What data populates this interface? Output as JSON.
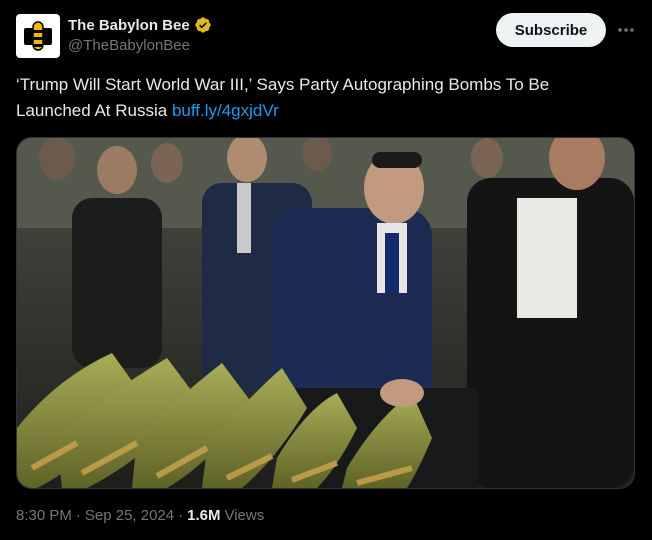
{
  "account": {
    "display_name": "The Babylon Bee",
    "handle": "@TheBabylonBee",
    "verified_icon": "verified-badge-icon",
    "avatar_icon": "babylon-bee-logo-icon"
  },
  "actions": {
    "subscribe_label": "Subscribe",
    "more_icon": "more-options-icon"
  },
  "tweet": {
    "text": "‘Trump Will Start World War III,’ Says Party Autographing Bombs To Be Launched At Russia",
    "link": "buff.ly/4gxjdVr"
  },
  "media": {
    "description_icon": "photo"
  },
  "meta": {
    "time": "8:30 PM",
    "separator1": "·",
    "date": "Sep 25, 2024",
    "separator2": "·",
    "views_count": "1.6M",
    "views_label": "Views"
  },
  "colors": {
    "background": "#000000",
    "text": "#e7e9ea",
    "secondary": "#71767b",
    "link": "#1d9bf0",
    "verified": "#e2b719",
    "button_bg": "#eff3f4"
  }
}
